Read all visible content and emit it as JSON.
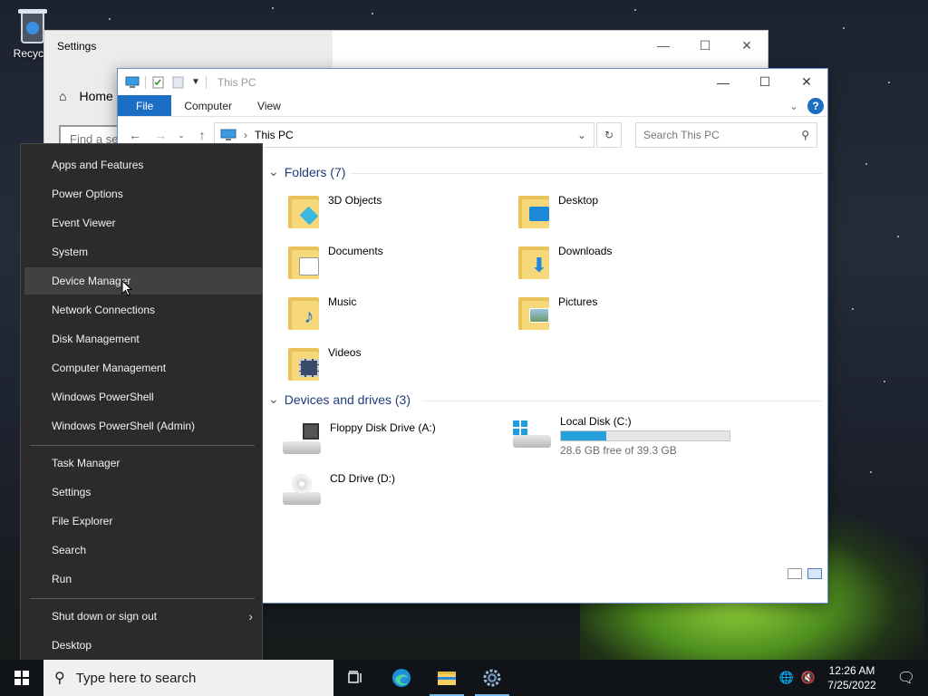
{
  "desktop": {
    "recycle_bin_label": "Recycle"
  },
  "settings_window": {
    "title": "Settings",
    "home_label": "Home",
    "find_placeholder": "Find a se"
  },
  "explorer": {
    "title": "This PC",
    "ribbon_tabs": [
      "File",
      "Computer",
      "View"
    ],
    "address": "This PC",
    "search_placeholder": "Search This PC",
    "folders_header": "Folders (7)",
    "folders": [
      {
        "name": "3D Objects",
        "icon": "3d-objects-icon"
      },
      {
        "name": "Desktop",
        "icon": "desktop-folder-icon"
      },
      {
        "name": "Documents",
        "icon": "documents-icon"
      },
      {
        "name": "Downloads",
        "icon": "downloads-icon"
      },
      {
        "name": "Music",
        "icon": "music-icon"
      },
      {
        "name": "Pictures",
        "icon": "pictures-icon"
      },
      {
        "name": "Videos",
        "icon": "videos-icon"
      }
    ],
    "drives_header": "Devices and drives (3)",
    "drives": [
      {
        "name": "Floppy Disk Drive (A:)",
        "icon": "floppy-drive-icon"
      },
      {
        "name": "Local Disk (C:)",
        "icon": "local-disk-icon",
        "free_text": "28.6 GB free of 39.3 GB",
        "used_fraction": 0.27
      },
      {
        "name": "CD Drive (D:)",
        "icon": "cd-drive-icon"
      }
    ],
    "accent_color": "#1a6fc4"
  },
  "winx_menu": {
    "group1": [
      "Apps and Features",
      "Power Options",
      "Event Viewer",
      "System",
      "Device Manager",
      "Network Connections",
      "Disk Management",
      "Computer Management",
      "Windows PowerShell",
      "Windows PowerShell (Admin)"
    ],
    "group2": [
      "Task Manager",
      "Settings",
      "File Explorer",
      "Search",
      "Run"
    ],
    "group3": [
      "Shut down or sign out",
      "Desktop"
    ],
    "hovered_item": "Device Manager"
  },
  "taskbar": {
    "search_placeholder": "Type here to search",
    "time": "12:26 AM",
    "date": "7/25/2022"
  }
}
